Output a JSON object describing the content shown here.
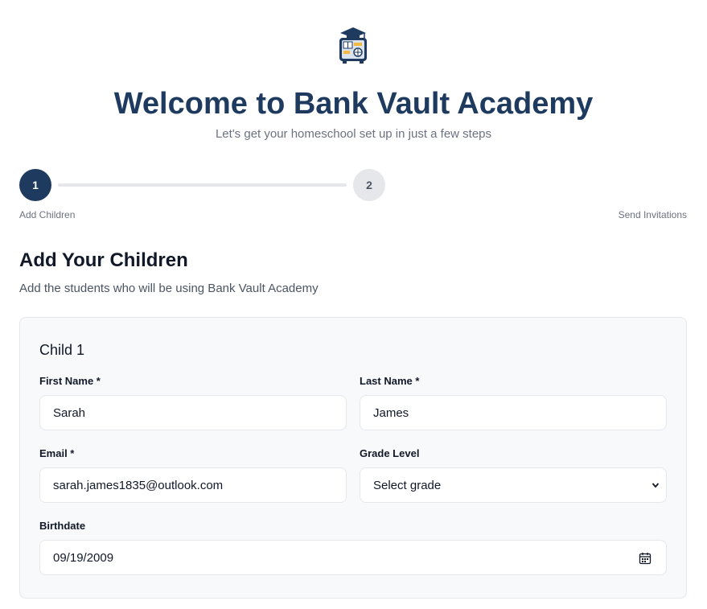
{
  "header": {
    "logo_icon": "vault-graduation-cap-icon",
    "title": "Welcome to Bank Vault Academy",
    "subtitle": "Let's get your homeschool set up in just a few steps"
  },
  "stepper": {
    "steps": [
      {
        "number": "1",
        "label": "Add Children",
        "state": "active"
      },
      {
        "number": "2",
        "label": "Send Invitations",
        "state": "inactive"
      }
    ]
  },
  "section": {
    "title": "Add Your Children",
    "subtitle": "Add the students who will be using Bank Vault Academy"
  },
  "child_card": {
    "title": "Child 1",
    "first_name": {
      "label": "First Name *",
      "value": "Sarah"
    },
    "last_name": {
      "label": "Last Name *",
      "value": "James"
    },
    "email": {
      "label": "Email *",
      "value": "sarah.james1835@outlook.com"
    },
    "grade_level": {
      "label": "Grade Level",
      "value": "Select grade"
    },
    "birthdate": {
      "label": "Birthdate",
      "value": "09/19/2009"
    }
  },
  "colors": {
    "primary": "#1e3a5f",
    "accent": "#f4b942",
    "muted": "#6b7280",
    "border": "#e5e7eb"
  }
}
